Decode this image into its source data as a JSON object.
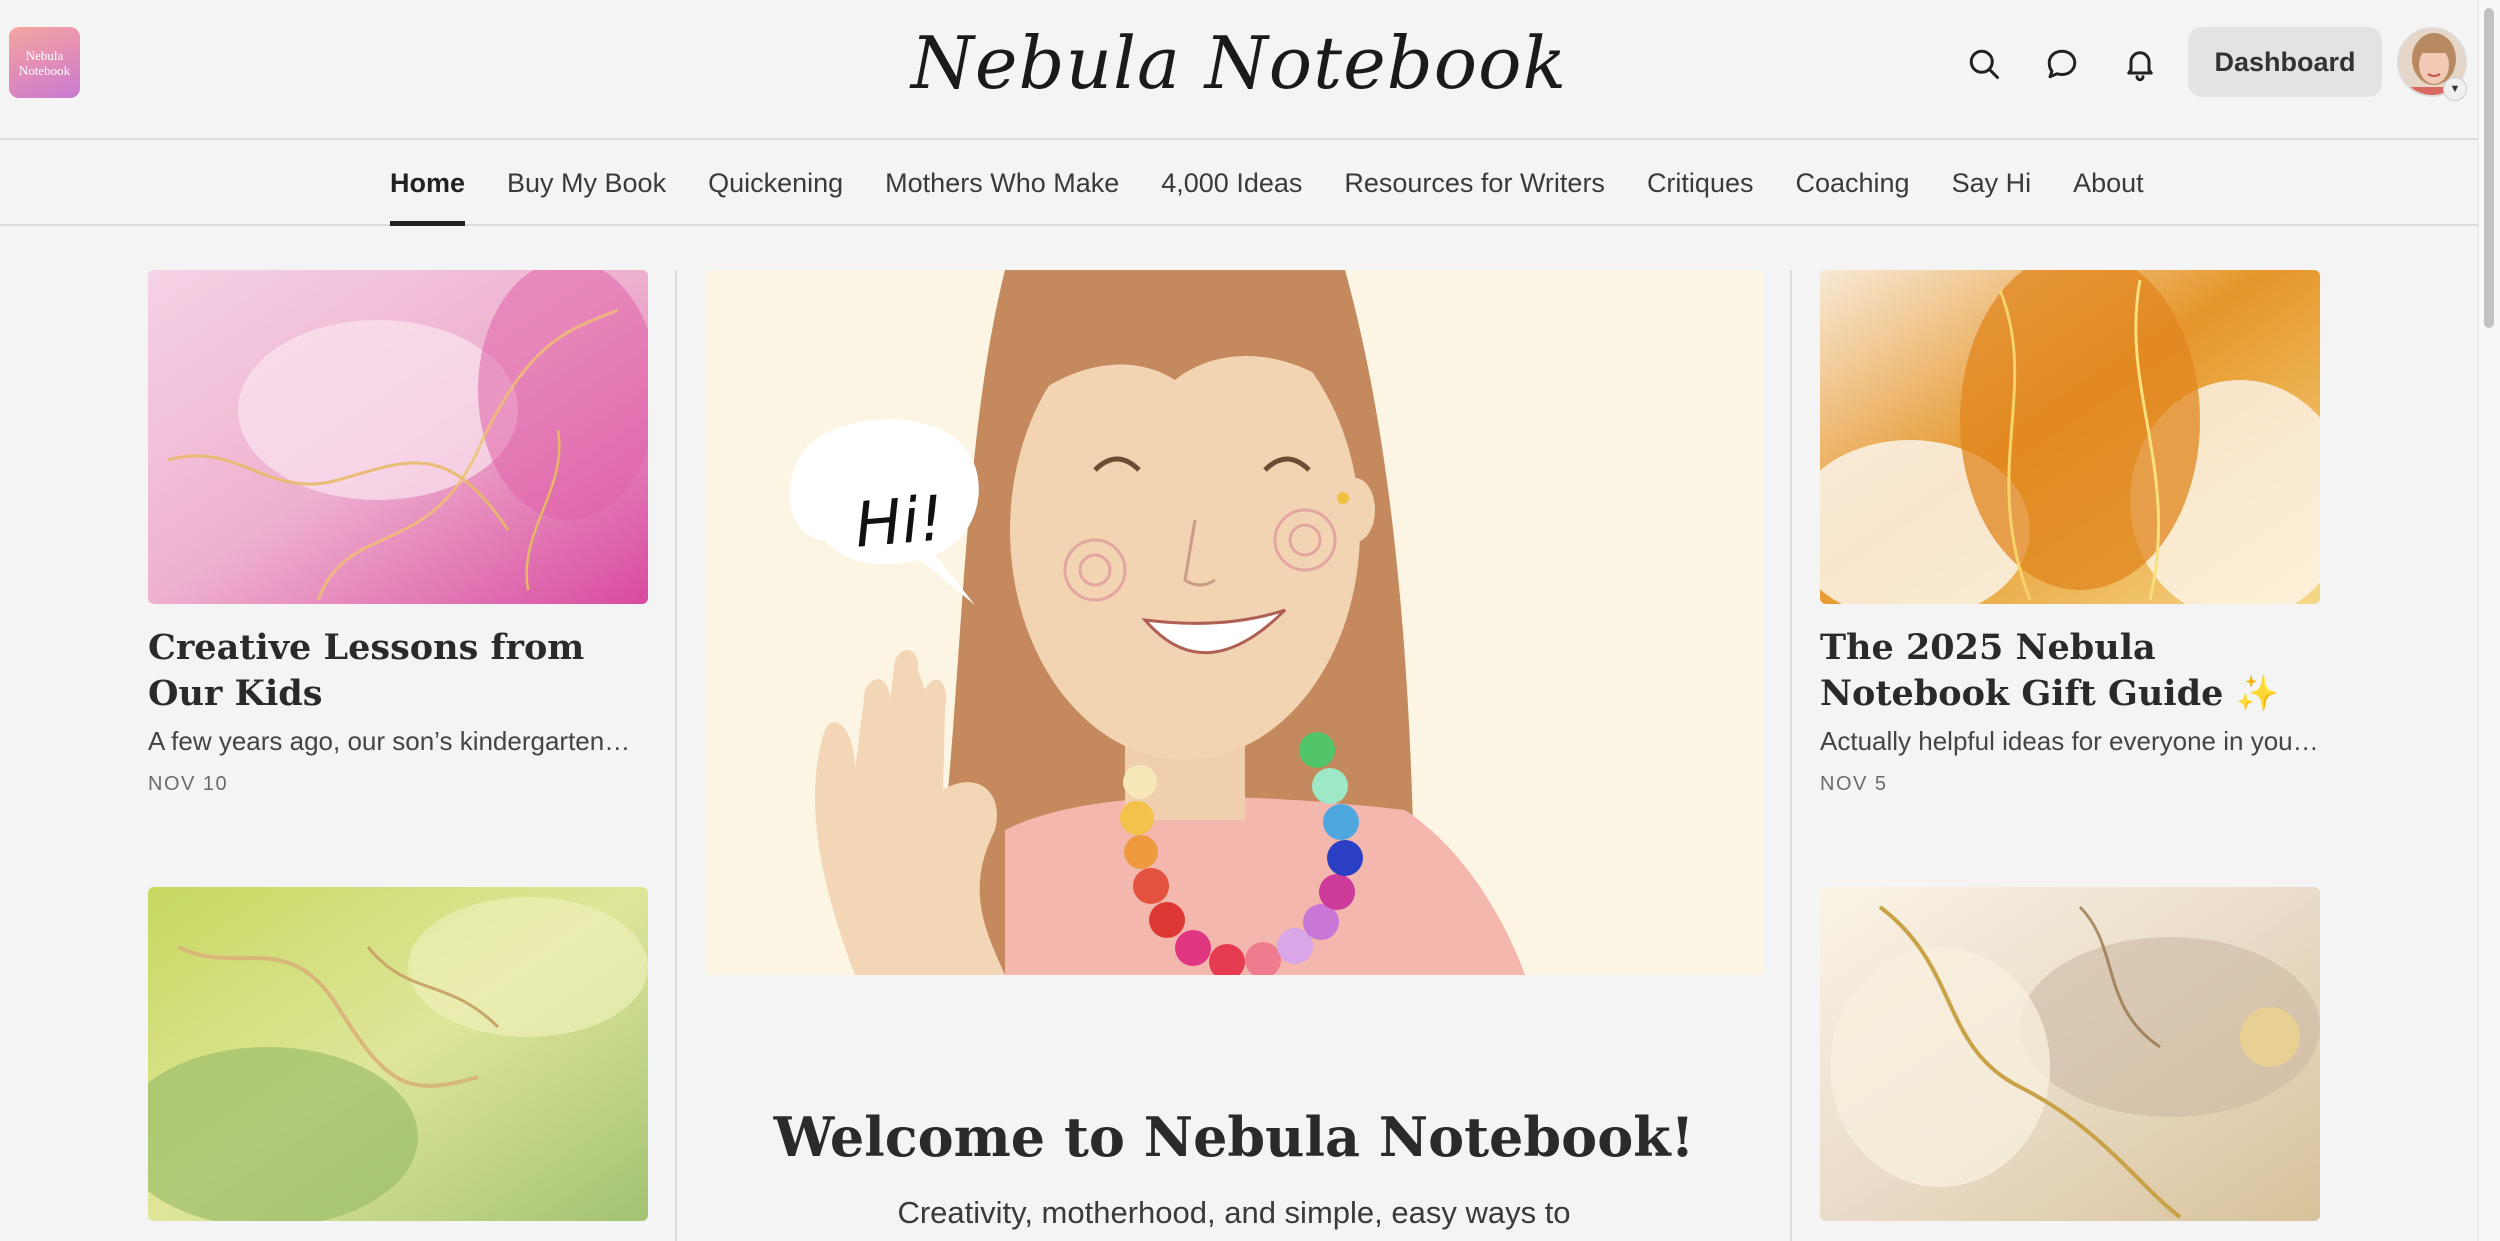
{
  "header": {
    "logo_line1": "Nebula",
    "logo_line2": "Notebook",
    "site_title": "Nebula Notebook",
    "dashboard_label": "Dashboard",
    "icons": [
      "search-icon",
      "chat-icon",
      "bell-icon"
    ]
  },
  "nav": {
    "items": [
      {
        "label": "Home",
        "active": true
      },
      {
        "label": "Buy My Book"
      },
      {
        "label": "Quickening"
      },
      {
        "label": "Mothers Who Make"
      },
      {
        "label": "4,000 Ideas"
      },
      {
        "label": "Resources for Writers"
      },
      {
        "label": "Critiques"
      },
      {
        "label": "Coaching"
      },
      {
        "label": "Say Hi"
      },
      {
        "label": "About"
      }
    ]
  },
  "left_posts": [
    {
      "title": "Creative Lessons from Our Kids",
      "excerpt": "A few years ago, our son’s kindergarten…",
      "date": "NOV 10"
    }
  ],
  "right_posts": [
    {
      "title": "The 2025 Nebula Notebook Gift Guide ✨",
      "excerpt": "Actually helpful ideas for everyone in your…",
      "date": "NOV 5"
    }
  ],
  "hero": {
    "speech_bubble": "Hi!",
    "welcome_title": "Welcome to Nebula Notebook!",
    "welcome_sub": "Creativity, motherhood, and simple, easy ways to"
  },
  "colors": {
    "background": "#f4f4f4",
    "hero_bg": "#fdf5e4",
    "button_bg": "#e3e3e3"
  }
}
